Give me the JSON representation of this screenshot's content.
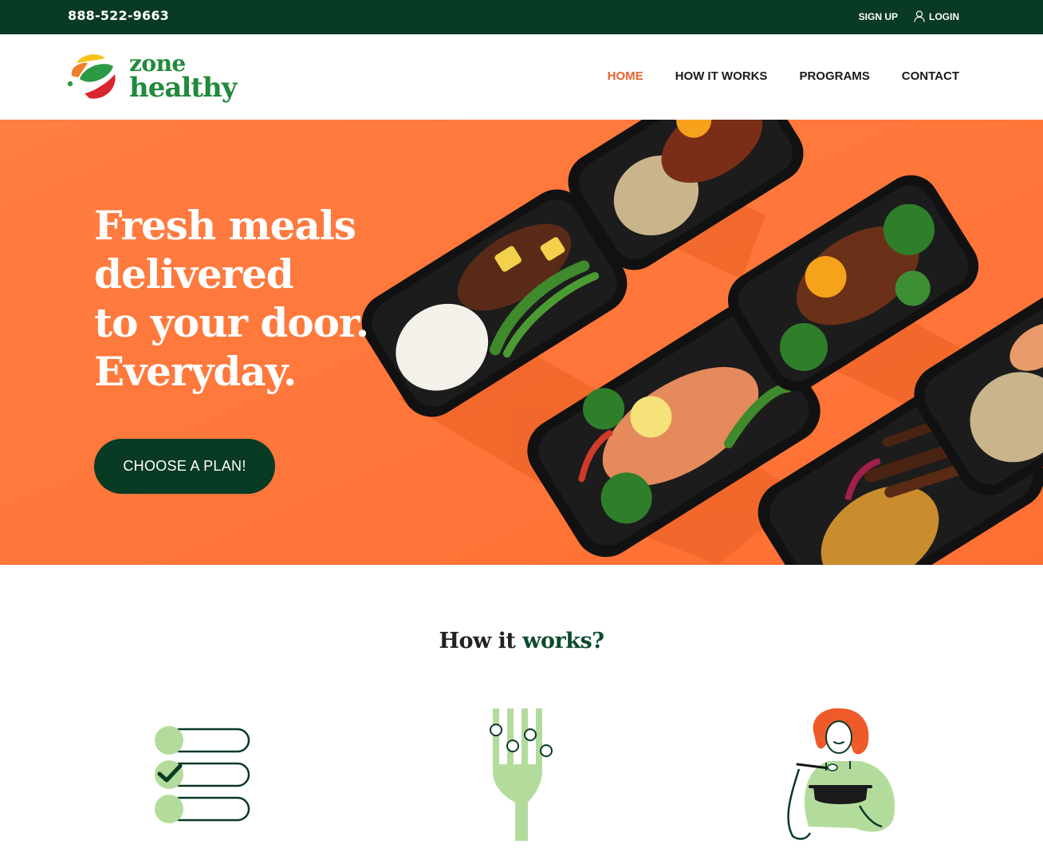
{
  "topbar": {
    "phone": "888-522-9663",
    "signup_label": "SIGN UP",
    "login_label": "LOGIN"
  },
  "brand": {
    "name_line1": "zone",
    "name_line2": "healthy"
  },
  "nav": {
    "items": [
      {
        "label": "HOME",
        "active": true
      },
      {
        "label": "HOW IT WORKS",
        "active": false
      },
      {
        "label": "PROGRAMS",
        "active": false
      },
      {
        "label": "CONTACT",
        "active": false
      }
    ]
  },
  "hero": {
    "lines": [
      "Fresh meals",
      "delivered",
      "to your door.",
      "Everyday."
    ],
    "cta_label": "CHOOSE A PLAN!"
  },
  "how": {
    "title_part1": "How it ",
    "title_part2": "works?",
    "steps": [
      {
        "icon": "checklist-icon"
      },
      {
        "icon": "fork-icon"
      },
      {
        "icon": "woman-eating-icon"
      }
    ]
  },
  "colors": {
    "dark_green": "#093a24",
    "brand_green": "#1f8a3b",
    "orange": "#ff7a3d",
    "nav_active": "#e8622a",
    "light_green": "#b3dc9c"
  }
}
